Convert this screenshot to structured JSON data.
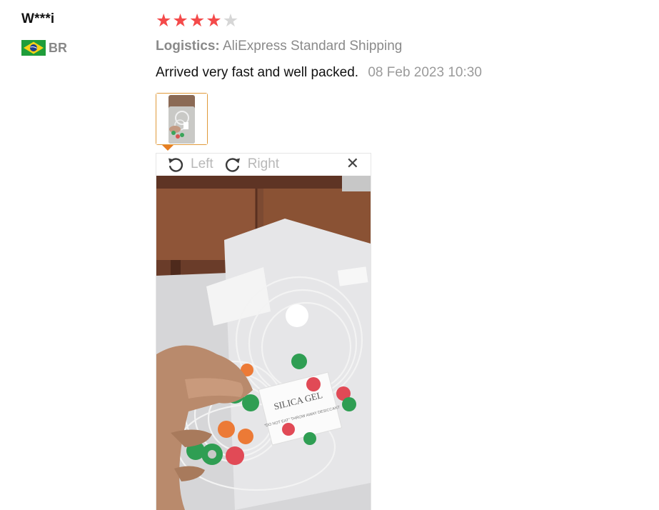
{
  "review": {
    "reviewer": "W***i",
    "country_code": "BR",
    "rating": 4,
    "max_rating": 5,
    "logistics_label": "Logistics:",
    "logistics_value": "AliExpress Standard Shipping",
    "text": "Arrived very fast and well packed.",
    "date": "08 Feb 2023 10:30"
  },
  "viewer": {
    "rotate_left_label": "Left",
    "rotate_right_label": "Right",
    "photo_label_title": "SILICA GEL",
    "photo_label_small": "\"DO NOT EAT\" THROW AWAY DESICCANT"
  },
  "colors": {
    "star_on": "#f44a4a",
    "star_off": "#d6d6d6",
    "thumb_border": "#e09a3a",
    "caret": "#e67e22"
  },
  "icons": {
    "flag": "brazil-flag-icon",
    "rotate_left": "rotate-left-icon",
    "rotate_right": "rotate-right-icon",
    "close": "close-icon",
    "star": "star-icon"
  }
}
